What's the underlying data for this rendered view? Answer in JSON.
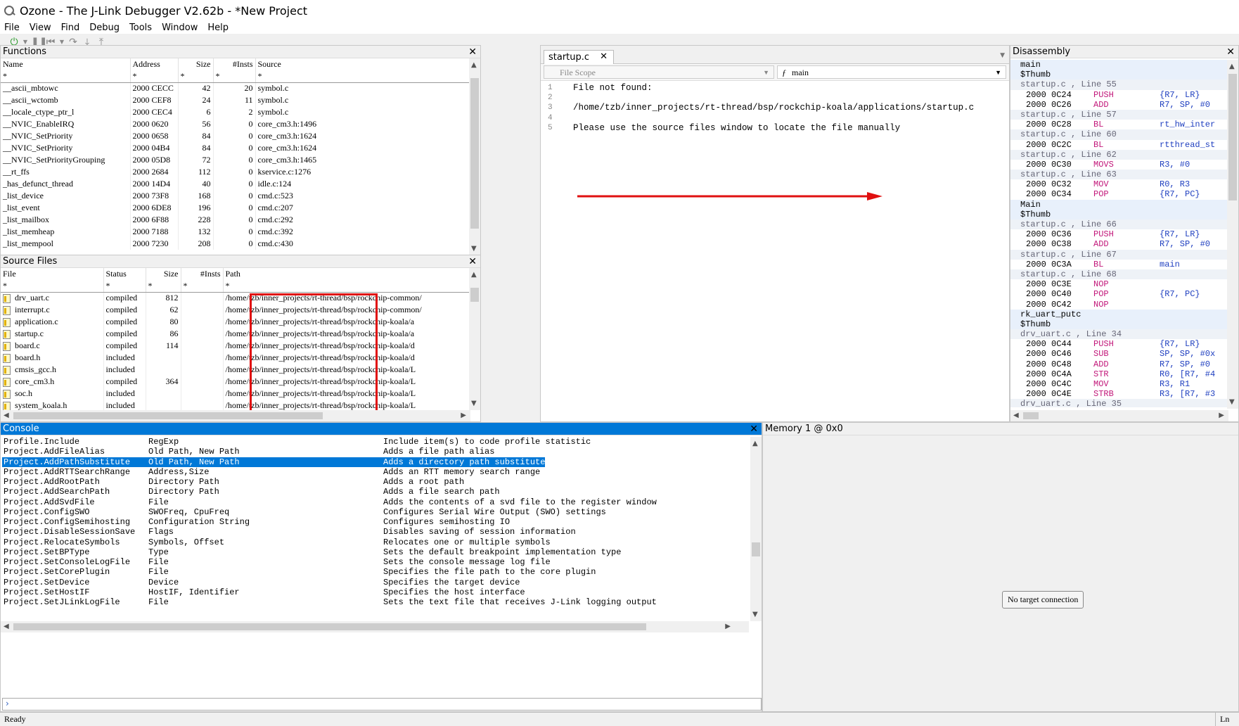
{
  "window": {
    "title": "Ozone - The J-Link Debugger V2.62b - *New Project"
  },
  "menu": [
    "File",
    "View",
    "Find",
    "Debug",
    "Tools",
    "Window",
    "Help"
  ],
  "functions": {
    "title": "Functions",
    "columns": [
      "Name",
      "Address",
      "Size",
      "#Insts",
      "Source"
    ],
    "filters": [
      "*",
      "*",
      "*",
      "*",
      "*"
    ],
    "rows": [
      [
        "__ascii_mbtowc",
        "2000 CECC",
        "42",
        "20",
        "symbol.c"
      ],
      [
        "__ascii_wctomb",
        "2000 CEF8",
        "24",
        "11",
        "symbol.c"
      ],
      [
        "__locale_ctype_ptr_l",
        "2000 CEC4",
        "6",
        "2",
        "symbol.c"
      ],
      [
        "__NVIC_EnableIRQ",
        "2000 0620",
        "56",
        "0",
        "core_cm3.h:1496"
      ],
      [
        "__NVIC_SetPriority",
        "2000 0658",
        "84",
        "0",
        "core_cm3.h:1624"
      ],
      [
        "__NVIC_SetPriority",
        "2000 04B4",
        "84",
        "0",
        "core_cm3.h:1624"
      ],
      [
        "__NVIC_SetPriorityGrouping",
        "2000 05D8",
        "72",
        "0",
        "core_cm3.h:1465"
      ],
      [
        "__rt_ffs",
        "2000 2684",
        "112",
        "0",
        "kservice.c:1276"
      ],
      [
        "_has_defunct_thread",
        "2000 14D4",
        "40",
        "0",
        "idle.c:124"
      ],
      [
        "_list_device",
        "2000 73F8",
        "168",
        "0",
        "cmd.c:523"
      ],
      [
        "_list_event",
        "2000 6DE8",
        "196",
        "0",
        "cmd.c:207"
      ],
      [
        "_list_mailbox",
        "2000 6F88",
        "228",
        "0",
        "cmd.c:292"
      ],
      [
        "_list_memheap",
        "2000 7188",
        "132",
        "0",
        "cmd.c:392"
      ],
      [
        "_list_mempool",
        "2000 7230",
        "208",
        "0",
        "cmd.c:430"
      ]
    ]
  },
  "source_files": {
    "title": "Source Files",
    "columns": [
      "File",
      "Status",
      "Size",
      "#Insts",
      "Path"
    ],
    "filters": [
      "*",
      "*",
      "*",
      "*",
      "*"
    ],
    "rows": [
      [
        "drv_uart.c",
        "compiled",
        "812",
        "",
        "/home/tzb/inner_projects/rt-thread/bsp/rockchip-common/"
      ],
      [
        "interrupt.c",
        "compiled",
        "62",
        "",
        "/home/tzb/inner_projects/rt-thread/bsp/rockchip-common/"
      ],
      [
        "application.c",
        "compiled",
        "80",
        "",
        "/home/tzb/inner_projects/rt-thread/bsp/rockchip-koala/a"
      ],
      [
        "startup.c",
        "compiled",
        "86",
        "",
        "/home/tzb/inner_projects/rt-thread/bsp/rockchip-koala/a"
      ],
      [
        "board.c",
        "compiled",
        "114",
        "",
        "/home/tzb/inner_projects/rt-thread/bsp/rockchip-koala/d"
      ],
      [
        "board.h",
        "included",
        "",
        "",
        "/home/tzb/inner_projects/rt-thread/bsp/rockchip-koala/d"
      ],
      [
        "cmsis_gcc.h",
        "included",
        "",
        "",
        "/home/tzb/inner_projects/rt-thread/bsp/rockchip-koala/L"
      ],
      [
        "core_cm3.h",
        "compiled",
        "364",
        "",
        "/home/tzb/inner_projects/rt-thread/bsp/rockchip-koala/L"
      ],
      [
        "soc.h",
        "included",
        "",
        "",
        "/home/tzb/inner_projects/rt-thread/bsp/rockchip-koala/L"
      ],
      [
        "system_koala.h",
        "included",
        "",
        "",
        "/home/tzb/inner_projects/rt-thread/bsp/rockchip-koala/L"
      ]
    ]
  },
  "editor": {
    "tab": "startup.c",
    "scope_placeholder": "File Scope",
    "function": "main",
    "lines": [
      {
        "n": "1",
        "text": "File not found:"
      },
      {
        "n": "2",
        "text": ""
      },
      {
        "n": "3",
        "text": "/home/tzb/inner_projects/rt-thread/bsp/rockchip-koala/applications/startup.c"
      },
      {
        "n": "4",
        "text": ""
      },
      {
        "n": "5",
        "text": "Please use the source files window to locate the file manually"
      }
    ]
  },
  "disassembly": {
    "title": "Disassembly",
    "lines": [
      {
        "k": "sym",
        "t": "main"
      },
      {
        "k": "sym",
        "t": "$Thumb"
      },
      {
        "k": "src",
        "t": "startup.c , Line 55"
      },
      {
        "k": "ins",
        "a": "2000 0C24",
        "m": "PUSH",
        "o": "{R7, LR}"
      },
      {
        "k": "ins",
        "a": "2000 0C26",
        "m": "ADD",
        "o": "R7, SP, #0"
      },
      {
        "k": "src",
        "t": "startup.c , Line 57"
      },
      {
        "k": "ins",
        "a": "2000 0C28",
        "m": "BL",
        "o": "rt_hw_inter"
      },
      {
        "k": "src",
        "t": "startup.c , Line 60"
      },
      {
        "k": "ins",
        "a": "2000 0C2C",
        "m": "BL",
        "o": "rtthread_st"
      },
      {
        "k": "src",
        "t": "startup.c , Line 62"
      },
      {
        "k": "ins",
        "a": "2000 0C30",
        "m": "MOVS",
        "o": "R3, #0"
      },
      {
        "k": "src",
        "t": "startup.c , Line 63"
      },
      {
        "k": "ins",
        "a": "2000 0C32",
        "m": "MOV",
        "o": "R0, R3"
      },
      {
        "k": "ins",
        "a": "2000 0C34",
        "m": "POP",
        "o": "{R7, PC}"
      },
      {
        "k": "sym",
        "t": "Main"
      },
      {
        "k": "sym",
        "t": "$Thumb"
      },
      {
        "k": "src",
        "t": "startup.c , Line 66"
      },
      {
        "k": "ins",
        "a": "2000 0C36",
        "m": "PUSH",
        "o": "{R7, LR}"
      },
      {
        "k": "ins",
        "a": "2000 0C38",
        "m": "ADD",
        "o": "R7, SP, #0"
      },
      {
        "k": "src",
        "t": "startup.c , Line 67"
      },
      {
        "k": "ins",
        "a": "2000 0C3A",
        "m": "BL",
        "o": "main"
      },
      {
        "k": "src",
        "t": "startup.c , Line 68"
      },
      {
        "k": "ins",
        "a": "2000 0C3E",
        "m": "NOP",
        "o": ""
      },
      {
        "k": "ins",
        "a": "2000 0C40",
        "m": "POP",
        "o": "{R7, PC}"
      },
      {
        "k": "ins",
        "a": "2000 0C42",
        "m": "NOP",
        "o": ""
      },
      {
        "k": "sym",
        "t": "rk_uart_putc"
      },
      {
        "k": "sym",
        "t": "$Thumb"
      },
      {
        "k": "src",
        "t": "drv_uart.c , Line 34"
      },
      {
        "k": "ins",
        "a": "2000 0C44",
        "m": "PUSH",
        "o": "{R7, LR}"
      },
      {
        "k": "ins",
        "a": "2000 0C46",
        "m": "SUB",
        "o": "SP, SP, #0x"
      },
      {
        "k": "ins",
        "a": "2000 0C48",
        "m": "ADD",
        "o": "R7, SP, #0"
      },
      {
        "k": "ins",
        "a": "2000 0C4A",
        "m": "STR",
        "o": "R0, [R7, #4"
      },
      {
        "k": "ins",
        "a": "2000 0C4C",
        "m": "MOV",
        "o": "R3, R1"
      },
      {
        "k": "ins",
        "a": "2000 0C4E",
        "m": "STRB",
        "o": "R3, [R7, #3"
      },
      {
        "k": "src",
        "t": "drv_uart.c , Line 35"
      }
    ]
  },
  "console": {
    "title": "Console",
    "selected_index": 2,
    "rows": [
      [
        "Profile.Include",
        "RegExp",
        "Include item(s) to code profile statistic"
      ],
      [
        "Project.AddFileAlias",
        "Old Path, New Path",
        "Adds a file path alias"
      ],
      [
        "Project.AddPathSubstitute",
        "Old Path, New Path",
        "Adds a directory path substitute"
      ],
      [
        "Project.AddRTTSearchRange",
        "Address,Size",
        "Adds an RTT memory search range"
      ],
      [
        "Project.AddRootPath",
        "Directory Path",
        "Adds a root path"
      ],
      [
        "Project.AddSearchPath",
        "Directory Path",
        "Adds a file search path"
      ],
      [
        "Project.AddSvdFile",
        "File",
        "Adds the contents of a svd file to the register window"
      ],
      [
        "Project.ConfigSWO",
        "SWOFreq, CpuFreq",
        "Configures Serial Wire Output (SWO) settings"
      ],
      [
        "Project.ConfigSemihosting",
        "Configuration String",
        "Configures semihosting IO"
      ],
      [
        "Project.DisableSessionSave",
        "Flags",
        "Disables saving of session information"
      ],
      [
        "Project.RelocateSymbols",
        "Symbols, Offset",
        "Relocates one or multiple symbols"
      ],
      [
        "Project.SetBPType",
        "Type",
        "Sets the default breakpoint implementation type"
      ],
      [
        "Project.SetConsoleLogFile",
        "File",
        "Sets the console message log file"
      ],
      [
        "Project.SetCorePlugin",
        "File",
        "Specifies the file path to the core plugin"
      ],
      [
        "Project.SetDevice",
        "Device",
        "Specifies the target device"
      ],
      [
        "Project.SetHostIF",
        "HostIF, Identifier",
        "Specifies the host interface"
      ],
      [
        "Project.SetJLinkLogFile",
        "File",
        "Sets the text file that receives J-Link logging output"
      ]
    ],
    "prompt": "›"
  },
  "memory": {
    "title": "Memory 1 @ 0x0",
    "message": "No target connection"
  },
  "status": {
    "left": "Ready",
    "right": "Ln"
  },
  "colors": {
    "accent": "#0078d7",
    "annotation": "#e01010",
    "mnemonic": "#c2187a",
    "operand": "#2040c0"
  }
}
